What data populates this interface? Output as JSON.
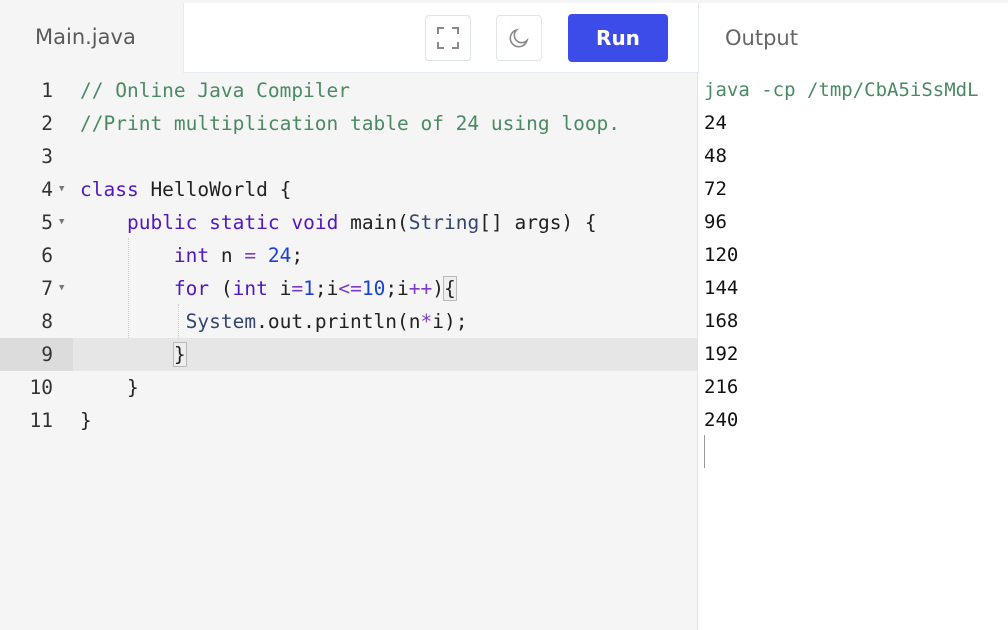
{
  "file_tab": {
    "label": "Main.java"
  },
  "toolbar": {
    "run_label": "Run",
    "fullscreen_icon": "fullscreen-icon",
    "theme_icon": "moon-icon"
  },
  "output_header": {
    "label": "Output"
  },
  "editor": {
    "lines": [
      {
        "n": "1",
        "text": "// Online Java Compiler"
      },
      {
        "n": "2",
        "text": "//Print multiplication table of 24 using loop."
      },
      {
        "n": "3",
        "text": ""
      },
      {
        "n": "4",
        "text": "class HelloWorld {"
      },
      {
        "n": "5",
        "text": "    public static void main(String[] args) {"
      },
      {
        "n": "6",
        "text": "        int n = 24;"
      },
      {
        "n": "7",
        "text": "        for (int i=1;i<=10;i++){"
      },
      {
        "n": "8",
        "text": "         System.out.println(n*i);"
      },
      {
        "n": "9",
        "text": "        }"
      },
      {
        "n": "10",
        "text": "    }"
      },
      {
        "n": "11",
        "text": "}"
      }
    ],
    "active_line": "9"
  },
  "output": {
    "command": "java -cp /tmp/CbA5iSsMdL",
    "lines": [
      "24",
      "48",
      "72",
      "96",
      "120",
      "144",
      "168",
      "192",
      "216",
      "240"
    ]
  },
  "colors": {
    "accent": "#3b4ce8",
    "comment": "#4a8a63",
    "keyword": "#5216c2"
  }
}
